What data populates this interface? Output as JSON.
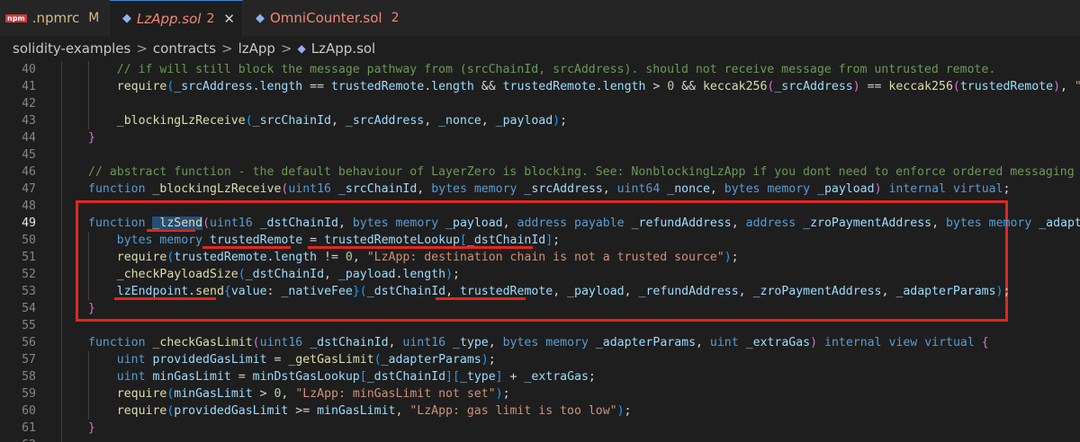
{
  "tabs": [
    {
      "icon": "npm-icon",
      "icon_text": "npm",
      "label": ".npmrc",
      "badge": "M",
      "active": false
    },
    {
      "icon": "solidity-icon",
      "icon_text": "◆",
      "label": "LzApp.sol",
      "badge": "2",
      "active": true,
      "close": "✕"
    },
    {
      "icon": "solidity-icon",
      "icon_text": "◆",
      "label": "OmniCounter.sol",
      "badge": "2",
      "active": false
    }
  ],
  "breadcrumb": {
    "items": [
      "solidity-examples",
      "contracts",
      "lzApp"
    ],
    "sep": ">",
    "file_icon": "◆",
    "file": "LzApp.sol"
  },
  "colors": {
    "annotation": "#e0271d",
    "selection": "#264f78",
    "modified": "#d7ba7d",
    "error_badge": "#f14c4c"
  },
  "lines": [
    {
      "n": "40",
      "tokens": [
        [
          "    // if will still block the message pathway from (srcChainId, srcAddress). should not receive message from untrusted remote.",
          "cm"
        ]
      ]
    },
    {
      "n": "41",
      "tokens": [
        [
          "    ",
          ""
        ],
        [
          "require",
          "fn"
        ],
        [
          "(",
          "br3"
        ],
        [
          "_srcAddress",
          "var"
        ],
        [
          ".",
          ""
        ],
        [
          "length",
          "var"
        ],
        [
          " == ",
          ""
        ],
        [
          "trustedRemote",
          "var"
        ],
        [
          ".",
          ""
        ],
        [
          "length",
          "var"
        ],
        [
          " && ",
          ""
        ],
        [
          "trustedRemote",
          "var"
        ],
        [
          ".",
          ""
        ],
        [
          "length",
          "var"
        ],
        [
          " > ",
          ""
        ],
        [
          "0",
          "num"
        ],
        [
          " && ",
          ""
        ],
        [
          "keccak256",
          "fn"
        ],
        [
          "(",
          "br2"
        ],
        [
          "_srcAddress",
          "var"
        ],
        [
          ")",
          "br2"
        ],
        [
          " == ",
          ""
        ],
        [
          "keccak256",
          "fn"
        ],
        [
          "(",
          "br2"
        ],
        [
          "trustedRemote",
          "var"
        ],
        [
          ")",
          "br2"
        ],
        [
          ", ",
          ""
        ],
        [
          "\"LzApp: in",
          "str"
        ]
      ]
    },
    {
      "n": "42",
      "tokens": []
    },
    {
      "n": "43",
      "tokens": [
        [
          "    ",
          ""
        ],
        [
          "_blockingLzReceive",
          "fn"
        ],
        [
          "(",
          "br3"
        ],
        [
          "_srcChainId",
          "var"
        ],
        [
          ", ",
          ""
        ],
        [
          "_srcAddress",
          "var"
        ],
        [
          ", ",
          ""
        ],
        [
          "_nonce",
          "var"
        ],
        [
          ", ",
          ""
        ],
        [
          "_payload",
          "var"
        ],
        [
          ")",
          "br3"
        ],
        [
          ";",
          ""
        ]
      ]
    },
    {
      "n": "44",
      "tokens": [
        [
          "}",
          "br2"
        ]
      ]
    },
    {
      "n": "45",
      "tokens": []
    },
    {
      "n": "46",
      "tokens": [
        [
          "// abstract function - the default behaviour of LayerZero is blocking. See: NonblockingLzApp if you dont need to enforce ordered messaging",
          "cm"
        ]
      ]
    },
    {
      "n": "47",
      "tokens": [
        [
          "function",
          "kw"
        ],
        [
          " ",
          ""
        ],
        [
          "_blockingLzReceive",
          "fn"
        ],
        [
          "(",
          "br2"
        ],
        [
          "uint16",
          "kw"
        ],
        [
          " ",
          ""
        ],
        [
          "_srcChainId",
          "var"
        ],
        [
          ", ",
          ""
        ],
        [
          "bytes",
          "kw"
        ],
        [
          " ",
          ""
        ],
        [
          "memory",
          "kw"
        ],
        [
          " ",
          ""
        ],
        [
          "_srcAddress",
          "var"
        ],
        [
          ", ",
          ""
        ],
        [
          "uint64",
          "kw"
        ],
        [
          " ",
          ""
        ],
        [
          "_nonce",
          "var"
        ],
        [
          ", ",
          ""
        ],
        [
          "bytes",
          "kw"
        ],
        [
          " ",
          ""
        ],
        [
          "memory",
          "kw"
        ],
        [
          " ",
          ""
        ],
        [
          "_payload",
          "var"
        ],
        [
          ")",
          "br2"
        ],
        [
          " ",
          ""
        ],
        [
          "internal",
          "kw"
        ],
        [
          " ",
          ""
        ],
        [
          "virtual",
          "kw"
        ],
        [
          ";",
          ""
        ]
      ]
    },
    {
      "n": "48",
      "tokens": []
    },
    {
      "n": "49",
      "current": true,
      "tokens": [
        [
          "function",
          "kw"
        ],
        [
          " ",
          ""
        ],
        [
          "_lzSend",
          "fn sel"
        ],
        [
          "(",
          "br2"
        ],
        [
          "uint16",
          "kw"
        ],
        [
          " ",
          ""
        ],
        [
          "_dstChainId",
          "var"
        ],
        [
          ", ",
          ""
        ],
        [
          "bytes",
          "kw"
        ],
        [
          " ",
          ""
        ],
        [
          "memory",
          "kw"
        ],
        [
          " ",
          ""
        ],
        [
          "_payload",
          "var"
        ],
        [
          ", ",
          ""
        ],
        [
          "address",
          "kw"
        ],
        [
          " ",
          ""
        ],
        [
          "payable",
          "kw"
        ],
        [
          " ",
          ""
        ],
        [
          "_refundAddress",
          "var"
        ],
        [
          ", ",
          ""
        ],
        [
          "address",
          "kw"
        ],
        [
          " ",
          ""
        ],
        [
          "_zroPaymentAddress",
          "var"
        ],
        [
          ", ",
          ""
        ],
        [
          "bytes",
          "kw"
        ],
        [
          " ",
          ""
        ],
        [
          "memory",
          "kw"
        ],
        [
          " ",
          ""
        ],
        [
          "_adapterParams",
          "var"
        ],
        [
          ",",
          ""
        ]
      ]
    },
    {
      "n": "50",
      "tokens": [
        [
          "    ",
          ""
        ],
        [
          "bytes",
          "kw"
        ],
        [
          " ",
          ""
        ],
        [
          "memory",
          "kw"
        ],
        [
          " ",
          ""
        ],
        [
          "trustedRemote",
          "var"
        ],
        [
          " = ",
          ""
        ],
        [
          "trustedRemoteLookup",
          "var"
        ],
        [
          "[",
          "br3"
        ],
        [
          "_dstChainId",
          "var"
        ],
        [
          "]",
          "br3"
        ],
        [
          ";",
          ""
        ]
      ]
    },
    {
      "n": "51",
      "tokens": [
        [
          "    ",
          ""
        ],
        [
          "require",
          "fn"
        ],
        [
          "(",
          "br3"
        ],
        [
          "trustedRemote",
          "var"
        ],
        [
          ".",
          ""
        ],
        [
          "length",
          "var"
        ],
        [
          " != ",
          ""
        ],
        [
          "0",
          "num"
        ],
        [
          ", ",
          ""
        ],
        [
          "\"LzApp: destination chain is not a trusted source\"",
          "str"
        ],
        [
          ")",
          "br3"
        ],
        [
          ";",
          ""
        ]
      ]
    },
    {
      "n": "52",
      "tokens": [
        [
          "    ",
          ""
        ],
        [
          "_checkPayloadSize",
          "fn"
        ],
        [
          "(",
          "br3"
        ],
        [
          "_dstChainId",
          "var"
        ],
        [
          ", ",
          ""
        ],
        [
          "_payload",
          "var"
        ],
        [
          ".",
          ""
        ],
        [
          "length",
          "var"
        ],
        [
          ")",
          "br3"
        ],
        [
          ";",
          ""
        ]
      ]
    },
    {
      "n": "53",
      "tokens": [
        [
          "    ",
          ""
        ],
        [
          "lzEndpoint",
          "var"
        ],
        [
          ".",
          ""
        ],
        [
          "send",
          "fn"
        ],
        [
          "{",
          "br3"
        ],
        [
          "value",
          "var"
        ],
        [
          ": ",
          ""
        ],
        [
          "_nativeFee",
          "var"
        ],
        [
          "}",
          "br3"
        ],
        [
          "(",
          "br3"
        ],
        [
          "_dstChainId",
          "var"
        ],
        [
          ", ",
          ""
        ],
        [
          "trustedRemote",
          "var"
        ],
        [
          ", ",
          ""
        ],
        [
          "_payload",
          "var"
        ],
        [
          ", ",
          ""
        ],
        [
          "_refundAddress",
          "var"
        ],
        [
          ", ",
          ""
        ],
        [
          "_zroPaymentAddress",
          "var"
        ],
        [
          ", ",
          ""
        ],
        [
          "_adapterParams",
          "var"
        ],
        [
          ")",
          "br3"
        ],
        [
          ";",
          ""
        ]
      ]
    },
    {
      "n": "54",
      "tokens": [
        [
          "}",
          "br2"
        ]
      ]
    },
    {
      "n": "55",
      "tokens": []
    },
    {
      "n": "56",
      "tokens": [
        [
          "function",
          "kw"
        ],
        [
          " ",
          ""
        ],
        [
          "_checkGasLimit",
          "fn"
        ],
        [
          "(",
          "br2"
        ],
        [
          "uint16",
          "kw"
        ],
        [
          " ",
          ""
        ],
        [
          "_dstChainId",
          "var"
        ],
        [
          ", ",
          ""
        ],
        [
          "uint16",
          "kw"
        ],
        [
          " ",
          ""
        ],
        [
          "_type",
          "var"
        ],
        [
          ", ",
          ""
        ],
        [
          "bytes",
          "kw"
        ],
        [
          " ",
          ""
        ],
        [
          "memory",
          "kw"
        ],
        [
          " ",
          ""
        ],
        [
          "_adapterParams",
          "var"
        ],
        [
          ", ",
          ""
        ],
        [
          "uint",
          "kw"
        ],
        [
          " ",
          ""
        ],
        [
          "_extraGas",
          "var"
        ],
        [
          ")",
          "br2"
        ],
        [
          " ",
          ""
        ],
        [
          "internal",
          "kw"
        ],
        [
          " ",
          ""
        ],
        [
          "view",
          "kw"
        ],
        [
          " ",
          ""
        ],
        [
          "virtual",
          "kw"
        ],
        [
          " ",
          ""
        ],
        [
          "{",
          "br2"
        ]
      ]
    },
    {
      "n": "57",
      "tokens": [
        [
          "    ",
          ""
        ],
        [
          "uint",
          "kw"
        ],
        [
          " ",
          ""
        ],
        [
          "providedGasLimit",
          "var"
        ],
        [
          " = ",
          ""
        ],
        [
          "_getGasLimit",
          "fn"
        ],
        [
          "(",
          "br3"
        ],
        [
          "_adapterParams",
          "var"
        ],
        [
          ")",
          "br3"
        ],
        [
          ";",
          ""
        ]
      ]
    },
    {
      "n": "58",
      "tokens": [
        [
          "    ",
          ""
        ],
        [
          "uint",
          "kw"
        ],
        [
          " ",
          ""
        ],
        [
          "minGasLimit",
          "var"
        ],
        [
          " = ",
          ""
        ],
        [
          "minDstGasLookup",
          "var"
        ],
        [
          "[",
          "br3"
        ],
        [
          "_dstChainId",
          "var"
        ],
        [
          "]",
          "br3"
        ],
        [
          "[",
          "br3"
        ],
        [
          "_type",
          "var"
        ],
        [
          "]",
          "br3"
        ],
        [
          " + ",
          ""
        ],
        [
          "_extraGas",
          "var"
        ],
        [
          ";",
          ""
        ]
      ]
    },
    {
      "n": "59",
      "tokens": [
        [
          "    ",
          ""
        ],
        [
          "require",
          "fn"
        ],
        [
          "(",
          "br3"
        ],
        [
          "minGasLimit",
          "var"
        ],
        [
          " > ",
          ""
        ],
        [
          "0",
          "num"
        ],
        [
          ", ",
          ""
        ],
        [
          "\"LzApp: minGasLimit not set\"",
          "str"
        ],
        [
          ")",
          "br3"
        ],
        [
          ";",
          ""
        ]
      ]
    },
    {
      "n": "60",
      "tokens": [
        [
          "    ",
          ""
        ],
        [
          "require",
          "fn"
        ],
        [
          "(",
          "br3"
        ],
        [
          "providedGasLimit",
          "var"
        ],
        [
          " >= ",
          ""
        ],
        [
          "minGasLimit",
          "var"
        ],
        [
          ", ",
          ""
        ],
        [
          "\"LzApp: gas limit is too low\"",
          "str"
        ],
        [
          ")",
          "br3"
        ],
        [
          ";",
          ""
        ]
      ]
    },
    {
      "n": "61",
      "tokens": [
        [
          "}",
          "br2"
        ]
      ]
    },
    {
      "n": "62",
      "tokens": []
    }
  ]
}
